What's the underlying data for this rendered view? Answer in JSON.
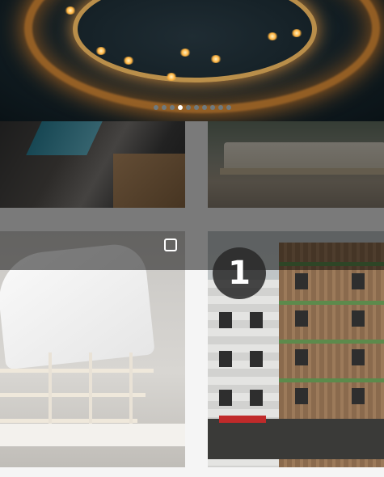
{
  "carousel": {
    "slide_count": 10,
    "active_index": 3
  },
  "feed": {
    "building_badge": "1"
  }
}
